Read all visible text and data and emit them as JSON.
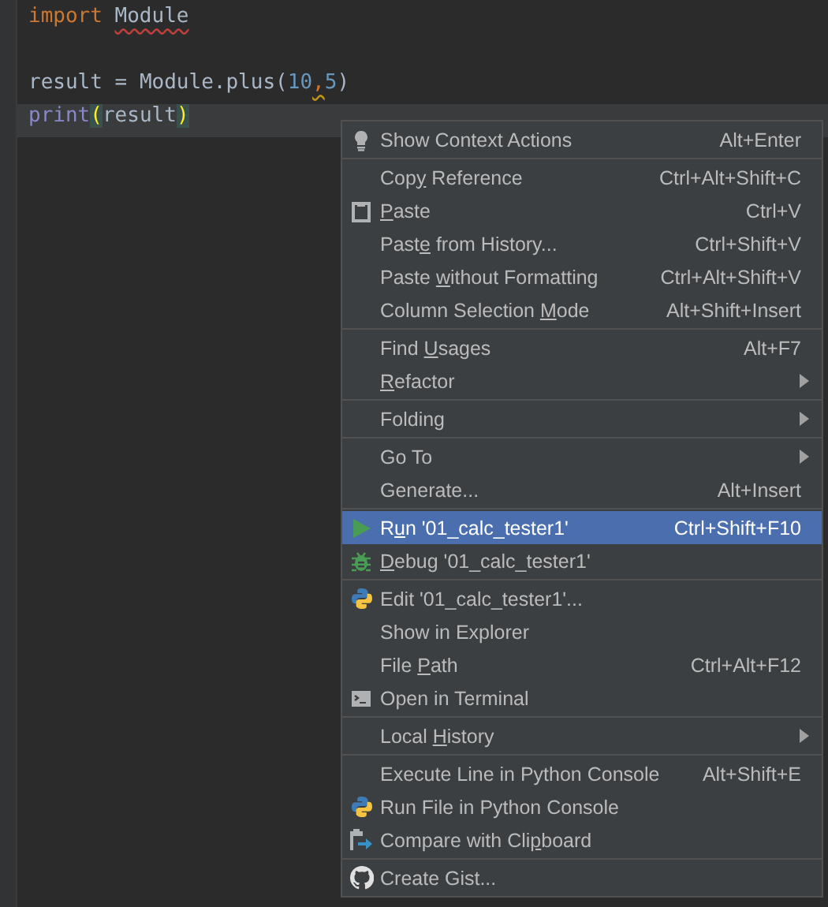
{
  "editor": {
    "lines": [
      {
        "current": false,
        "tokens": [
          {
            "text": "import",
            "kind": "keyword"
          },
          {
            "text": "Module",
            "kind": "unresolved",
            "space_before": true
          }
        ]
      },
      {
        "current": false
      },
      {
        "current": false,
        "tokens": [
          {
            "text": "result = Module.plus(",
            "kind": "plain"
          },
          {
            "text": "10",
            "kind": "number"
          },
          {
            "text": ",",
            "kind": "warning"
          },
          {
            "text": "5",
            "kind": "number"
          },
          {
            "text": ")",
            "kind": "plain"
          }
        ]
      },
      {
        "current": true,
        "tokens": [
          {
            "text": "print",
            "kind": "builtin"
          },
          {
            "text": "(",
            "kind": "brace-match"
          },
          {
            "text": "result",
            "kind": "plain"
          },
          {
            "text": ")",
            "kind": "brace-match"
          }
        ]
      }
    ]
  },
  "context_menu": {
    "groups": [
      {
        "items": [
          {
            "kind": "bulb",
            "label": "Show Context Actions",
            "shortcut": "Alt+Enter",
            "submenu": false,
            "selected": false
          }
        ]
      },
      {
        "items": [
          {
            "kind": "plain",
            "label": "Cop",
            "mnemonic": "y",
            "label_after": " Reference",
            "shortcut": "Ctrl+Alt+Shift+C",
            "submenu": false,
            "selected": false
          },
          {
            "kind": "clipboard",
            "mnemonic": "P",
            "label_after": "aste",
            "shortcut": "Ctrl+V",
            "submenu": false,
            "selected": false
          },
          {
            "kind": "plain",
            "label": "Past",
            "mnemonic": "e",
            "label_after": " from History...",
            "shortcut": "Ctrl+Shift+V",
            "submenu": false,
            "selected": false
          },
          {
            "kind": "plain",
            "label": "Paste ",
            "mnemonic": "w",
            "label_after": "ithout Formatting",
            "shortcut": "Ctrl+Alt+Shift+V",
            "submenu": false,
            "selected": false
          },
          {
            "kind": "plain",
            "label": "Column Selection ",
            "mnemonic": "M",
            "label_after": "ode",
            "shortcut": "Alt+Shift+Insert",
            "submenu": false,
            "selected": false
          }
        ]
      },
      {
        "items": [
          {
            "kind": "plain",
            "label": "Find ",
            "mnemonic": "U",
            "label_after": "sages",
            "shortcut": "Alt+F7",
            "submenu": false,
            "selected": false
          },
          {
            "kind": "plain",
            "mnemonic": "R",
            "label_after": "efactor",
            "submenu": true,
            "selected": false
          }
        ]
      },
      {
        "items": [
          {
            "kind": "plain",
            "label": "Folding",
            "submenu": true,
            "selected": false
          }
        ]
      },
      {
        "items": [
          {
            "kind": "plain",
            "label": "Go To",
            "submenu": true,
            "selected": false
          },
          {
            "kind": "plain",
            "label": "Generate...",
            "shortcut": "Alt+Insert",
            "submenu": false,
            "selected": false
          }
        ]
      },
      {
        "items": [
          {
            "kind": "run",
            "label": "R",
            "mnemonic": "u",
            "label_after": "n '01_calc_tester1'",
            "shortcut": "Ctrl+Shift+F10",
            "submenu": false,
            "selected": true
          },
          {
            "kind": "bug",
            "mnemonic": "D",
            "label_after": "ebug '01_calc_tester1'",
            "submenu": false,
            "selected": false
          }
        ]
      },
      {
        "items": [
          {
            "kind": "python",
            "label": "Edit '01_calc_tester1'...",
            "submenu": false,
            "selected": false
          },
          {
            "kind": "plain",
            "label": "Show in Explorer",
            "submenu": false,
            "selected": false
          },
          {
            "kind": "plain",
            "label": "File ",
            "mnemonic": "P",
            "label_after": "ath",
            "shortcut": "Ctrl+Alt+F12",
            "submenu": false,
            "selected": false
          },
          {
            "kind": "terminal",
            "label": "Open in Terminal",
            "submenu": false,
            "selected": false
          }
        ]
      },
      {
        "items": [
          {
            "kind": "plain",
            "label": "Local ",
            "mnemonic": "H",
            "label_after": "istory",
            "submenu": true,
            "selected": false
          }
        ]
      },
      {
        "items": [
          {
            "kind": "plain",
            "label": "Execute Line in Python Console",
            "shortcut": "Alt+Shift+E",
            "submenu": false,
            "selected": false
          },
          {
            "kind": "python",
            "label": "Run File in Python Console",
            "submenu": false,
            "selected": false
          },
          {
            "kind": "compare",
            "label": "Compare with Cli",
            "mnemonic": "p",
            "label_after": "board",
            "submenu": false,
            "selected": false
          }
        ]
      },
      {
        "items": [
          {
            "kind": "cat",
            "label": "Create Gist...",
            "submenu": false,
            "selected": false
          }
        ]
      }
    ]
  }
}
